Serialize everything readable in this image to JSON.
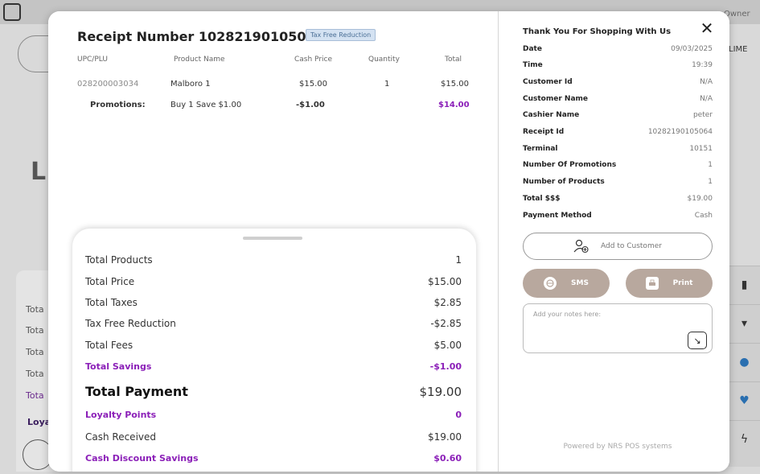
{
  "background": {
    "owner_label": "Owner",
    "lime_label": "LIME",
    "big_letter": "L",
    "left_labels": [
      "Tota",
      "Tota",
      "Tota",
      "Tota",
      "Tota"
    ],
    "loyalty_label": "Loya",
    "colors": {
      "purple": "#8b1fb8"
    }
  },
  "receipt": {
    "title": "Receipt Number 10282190105064",
    "badge": "Tax Free Reduction",
    "columns": [
      "UPC/PLU",
      "Product Name",
      "Cash Price",
      "Quantity",
      "Total"
    ],
    "item": {
      "upc": "028200003034",
      "name": "Malboro 1",
      "price": "$15.00",
      "quantity": "1",
      "total": "$15.00"
    },
    "promotion": {
      "label": "Promotions:",
      "name": "Buy 1 Save $1.00",
      "discount": "-$1.00",
      "total": "$14.00"
    }
  },
  "summary": {
    "total_products_label": "Total Products",
    "total_products": "1",
    "total_price_label": "Total Price",
    "total_price": "$15.00",
    "total_taxes_label": "Total Taxes",
    "total_taxes": "$2.85",
    "tax_free_label": "Tax Free Reduction",
    "tax_free": "-$2.85",
    "total_fees_label": "Total Fees",
    "total_fees": "$5.00",
    "total_savings_label": "Total Savings",
    "total_savings": "-$1.00",
    "total_payment_label": "Total Payment",
    "total_payment": "$19.00",
    "loyalty_label": "Loyalty Points",
    "loyalty": "0",
    "cash_received_label": "Cash Received",
    "cash_received": "$19.00",
    "cash_discount_label": "Cash Discount Savings",
    "cash_discount": "$0.60"
  },
  "details": {
    "thank_you": "Thank You For Shopping With Us",
    "date_label": "Date",
    "date": "09/03/2025",
    "time_label": "Time",
    "time": "19:39",
    "customer_id_label": "Customer Id",
    "customer_id": "N/A",
    "customer_name_label": "Customer Name",
    "customer_name": "N/A",
    "cashier_label": "Cashier Name",
    "cashier": "peter",
    "receipt_id_label": "Receipt Id",
    "receipt_id": "10282190105064",
    "terminal_label": "Terminal",
    "terminal": "10151",
    "promotions_label": "Number Of Promotions",
    "promotions": "1",
    "products_label": "Number of Products",
    "products": "1",
    "total_label": "Total $$$",
    "total": "$19.00",
    "payment_label": "Payment Method",
    "payment": "Cash"
  },
  "actions": {
    "add_customer": "Add to Customer",
    "sms": "SMS",
    "print": "Print",
    "notes_placeholder": "Add your notes here:",
    "powered_by": "Powered by NRS POS systems"
  }
}
